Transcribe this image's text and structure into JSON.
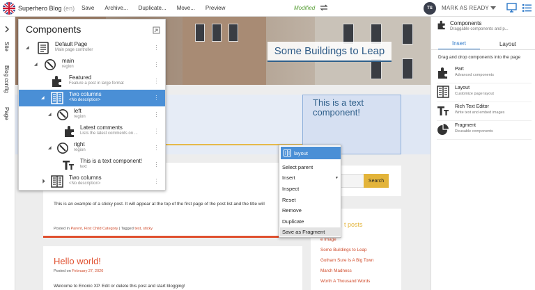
{
  "toolbar": {
    "site_title": "Superhero Blog",
    "language": "(en)",
    "buttons": [
      "Save",
      "Archive...",
      "Duplicate...",
      "Move...",
      "Preview"
    ],
    "status": "Modified",
    "avatar_initials": "TS",
    "mark_as_ready": "MARK AS READY"
  },
  "rail": {
    "tabs": [
      "Site",
      "Blog config",
      "Page"
    ]
  },
  "page": {
    "hero_title": "Some Buildings to Leap",
    "text_component": "This is a text component!",
    "sticky_text": "This is an example of a sticky post. It will appear at the top of the first page of the post list and the title will",
    "sticky_meta": {
      "prefix": "Posted in",
      "cat1": "Parent",
      "cat2": "First Child Category",
      "tag_prefix": "| Tagged",
      "tag1": "test",
      "tag2": "sticky"
    },
    "hello_title": "Hello world!",
    "hello_meta": {
      "prefix": "Posted on",
      "date": "February 27, 2020"
    },
    "hello_body": "Welcome to Enonic XP. Edit or delete this post and start blogging!",
    "search_button": "Search",
    "recent_title": "t posts",
    "recent_links": [
      "e Image",
      "Some Buildings to Leap",
      "Gotham Sure Is A Big Town",
      "March Madness",
      "Worth A Thousand Words"
    ]
  },
  "tree": {
    "title": "Components",
    "rows": [
      {
        "name": "Default Page",
        "sub": "Main page controller",
        "icon": "page-icon"
      },
      {
        "name": "main",
        "sub": "region",
        "icon": "region-icon"
      },
      {
        "name": "Featured",
        "sub": "Feature a post in large format",
        "icon": "part-icon"
      },
      {
        "name": "Two columns",
        "sub": "<No description>",
        "icon": "layout-icon"
      },
      {
        "name": "left",
        "sub": "region",
        "icon": "region-icon"
      },
      {
        "name": "Latest comments",
        "sub": "Lists the latest comments on ...",
        "icon": "part-icon"
      },
      {
        "name": "right",
        "sub": "region",
        "icon": "region-icon"
      },
      {
        "name": "This is a text component!",
        "sub": "text",
        "icon": "text-icon"
      },
      {
        "name": "Two columns",
        "sub": "<No description>",
        "icon": "layout-icon"
      }
    ]
  },
  "context_menu": {
    "header": "layout",
    "items": [
      "Select parent",
      "Insert",
      "Inspect",
      "Reset",
      "Remove",
      "Duplicate",
      "Save as Fragment"
    ]
  },
  "right_panel": {
    "title": "Components",
    "subtitle": "Draggable components and p...",
    "tabs": [
      "Insert",
      "Layout"
    ],
    "hint": "Drag and drop components into the page",
    "items": [
      {
        "title": "Part",
        "desc": "Advanced components",
        "icon": "part-icon"
      },
      {
        "title": "Layout",
        "desc": "Customize page layout",
        "icon": "layout-icon"
      },
      {
        "title": "Rich Text Editor",
        "desc": "Write text and embed images",
        "icon": "text-icon"
      },
      {
        "title": "Fragment",
        "desc": "Reusable components",
        "icon": "fragment-icon"
      }
    ]
  }
}
